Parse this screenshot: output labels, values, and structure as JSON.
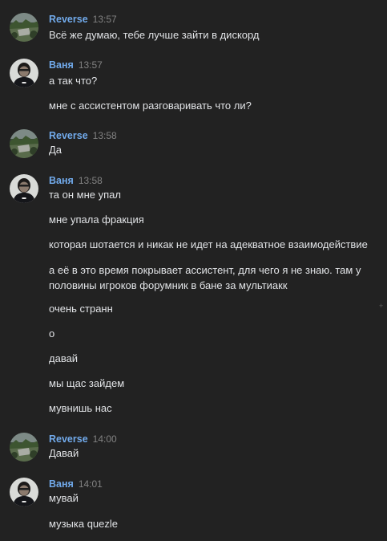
{
  "messages": [
    {
      "author": "Reverse",
      "time": "13:57",
      "avatar": "landscape-avatar",
      "lines": [
        "Всё же думаю, тебе лучше зайти в дискорд"
      ]
    },
    {
      "author": "Ваня",
      "time": "13:57",
      "avatar": "person-avatar",
      "lines": [
        "а так что?",
        "мне с ассистентом разговаривать что ли?"
      ]
    },
    {
      "author": "Reverse",
      "time": "13:58",
      "avatar": "landscape-avatar",
      "lines": [
        "Да"
      ]
    },
    {
      "author": "Ваня",
      "time": "13:58",
      "avatar": "person-avatar",
      "lines": [
        "та он мне упал",
        "мне упала фракция",
        "которая шотается и никак не идет на адекватное взаимодействие",
        "а её в это время покрывает ассистент, для чего я не знаю. там у половины игроков форумник в бане за мультиакк",
        "очень странн",
        "о",
        "давай",
        "мы щас зайдем",
        "мувнишь нас"
      ]
    },
    {
      "author": "Reverse",
      "time": "14:00",
      "avatar": "landscape-avatar",
      "lines": [
        "Давай"
      ]
    },
    {
      "author": "Ваня",
      "time": "14:01",
      "avatar": "person-avatar",
      "lines": [
        "мувай",
        "музыка quezle"
      ]
    }
  ],
  "colors": {
    "background": "#222222",
    "author": "#71aaeb",
    "text": "#e1e3e6",
    "time": "#828282"
  }
}
